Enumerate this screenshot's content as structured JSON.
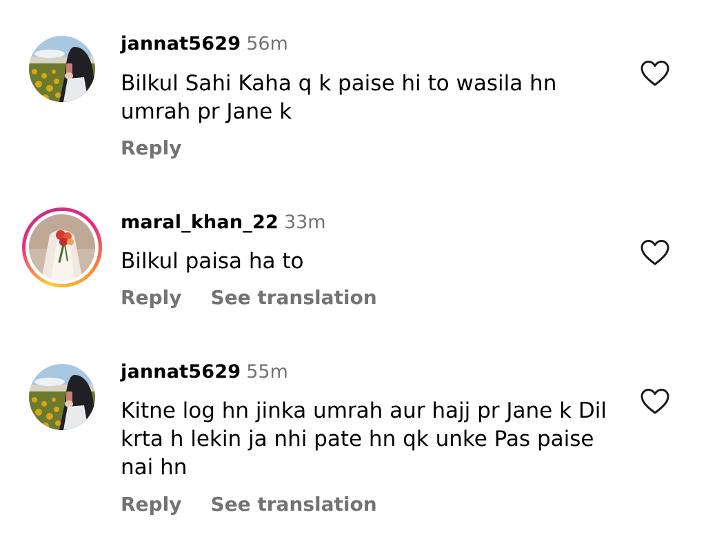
{
  "comments": [
    {
      "username": "jannat5629",
      "time": "56m",
      "text": "Bilkul Sahi Kaha q k paise hi to wasila hn umrah pr Jane k",
      "actions": [
        "Reply"
      ],
      "avatar_icon": "sunflower-field-avatar",
      "has_story_ring": false
    },
    {
      "username": "maral_khan_22",
      "time": "33m",
      "text": "Bilkul paisa ha to",
      "actions": [
        "Reply",
        "See translation"
      ],
      "avatar_icon": "bride-with-flowers-avatar",
      "has_story_ring": true
    },
    {
      "username": "jannat5629",
      "time": "55m",
      "text": "Kitne log hn jinka umrah aur hajj pr Jane k Dil krta h lekin ja nhi pate hn qk unke Pas paise nai hn",
      "actions": [
        "Reply",
        "See translation"
      ],
      "avatar_icon": "sunflower-field-avatar",
      "has_story_ring": false
    }
  ],
  "colors": {
    "muted_text": "#737373",
    "primary_text": "#000000",
    "story_ring": [
      "#f9ce34",
      "#ee2a7b",
      "#c13584"
    ]
  }
}
